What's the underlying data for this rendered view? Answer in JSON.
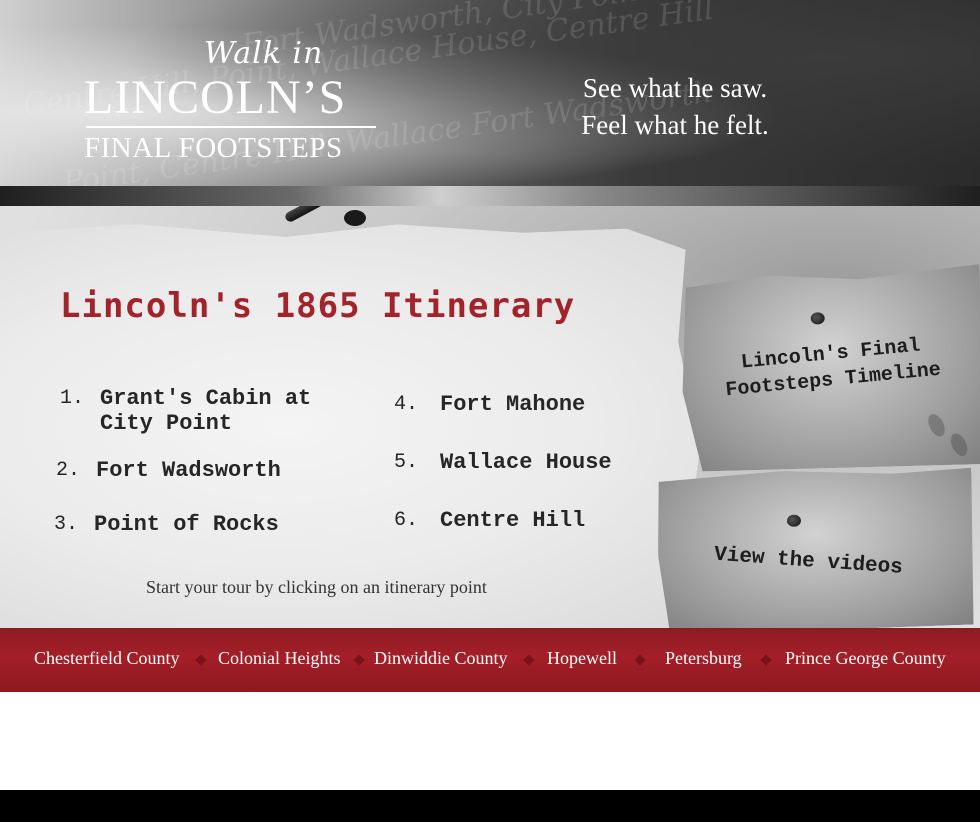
{
  "header": {
    "logo": {
      "walk_in": "Walk in",
      "lincolns": "LINCOLN’S",
      "final_footsteps": "FINAL FOOTSTEPS"
    },
    "tagline_line1": "See what he saw.",
    "tagline_line2": "Feel what he felt.",
    "background_script": [
      "Fort Wadsworth, City Point",
      "Centre Hill, Point, Wallace House, Centre Hill",
      "Point, Centre Hill, Wallace Fort Wadsworth"
    ]
  },
  "itinerary": {
    "title": "Lincoln's 1865 Itinerary",
    "items": [
      {
        "number": "1.",
        "label": "Grant's Cabin at\nCity Point"
      },
      {
        "number": "2.",
        "label": "Fort Wadsworth"
      },
      {
        "number": "3.",
        "label": "Point of Rocks"
      },
      {
        "number": "4.",
        "label": "Fort Mahone"
      },
      {
        "number": "5.",
        "label": "Wallace House"
      },
      {
        "number": "6.",
        "label": "Centre Hill"
      }
    ],
    "hint": "Start your tour by clicking on an itinerary point"
  },
  "cards": {
    "timeline": "Lincoln's Final Footsteps Timeline",
    "videos": "View the videos"
  },
  "counties": [
    "Chesterfield County",
    "Colonial Heights",
    "Dinwiddie County",
    "Hopewell",
    "Petersburg",
    "Prince George County"
  ],
  "colors": {
    "accent_red": "#a3232b",
    "county_bar": "#9e1d26"
  }
}
